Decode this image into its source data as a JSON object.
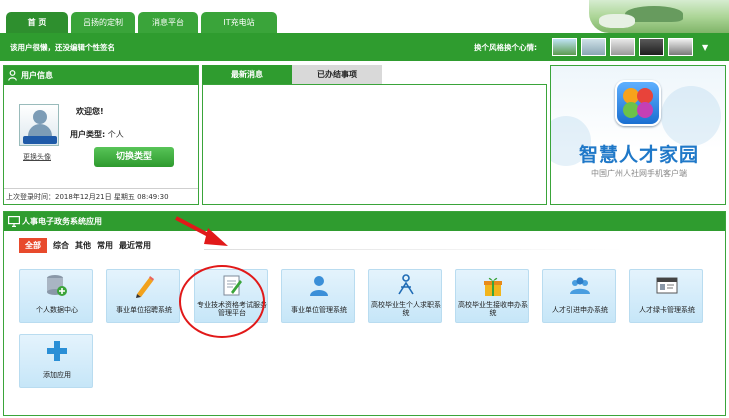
{
  "topnav": {
    "tabs": [
      {
        "label": "首 页"
      },
      {
        "label": "吕扬的定制"
      },
      {
        "label": "消息平台"
      },
      {
        "label": "IT充电站"
      }
    ]
  },
  "greenbar": {
    "signature_prompt": "该用户很懒，还没编辑个性签名",
    "style_label": "换个风格换个心情:",
    "style_options": [
      "landscape",
      "plane",
      "car",
      "dark-car",
      "silver-car"
    ]
  },
  "user_panel": {
    "title": "用户信息",
    "welcome": "欢迎您!",
    "user_type_label": "用户类型:",
    "user_type_value": "个人",
    "change_avatar": "更换头像",
    "switch_button": "切换类型",
    "last_login": "上次登录时间：2018年12月21日 星期五 08:49:30"
  },
  "news_panel": {
    "tabs": [
      {
        "label": "最新消息",
        "active": true
      },
      {
        "label": "已办结事项",
        "active": false
      }
    ]
  },
  "promo": {
    "title": "智慧人才家园",
    "subtitle": "中国广州人社网手机客户端"
  },
  "apps_panel": {
    "title": "人事电子政务系统应用",
    "filters": [
      {
        "label": "全部",
        "active": true
      },
      {
        "label": "综合",
        "active": false
      },
      {
        "label": "其他",
        "active": false
      },
      {
        "label": "常用",
        "active": false
      },
      {
        "label": "最近常用",
        "active": false
      }
    ],
    "apps": [
      {
        "label": "个人数据中心",
        "icon": "database-add-icon"
      },
      {
        "label": "事业单位招聘系统",
        "icon": "pencil-icon"
      },
      {
        "label": "专业技术资格考试服务管理平台",
        "icon": "document-icon"
      },
      {
        "label": "事业单位管理系统",
        "icon": "person-icon"
      },
      {
        "label": "高校毕业生个人求职系统",
        "icon": "figure-icon"
      },
      {
        "label": "高校毕业生接收申办系统",
        "icon": "gift-icon"
      },
      {
        "label": "人才引进申办系统",
        "icon": "group-icon"
      },
      {
        "label": "人才绿卡管理系统",
        "icon": "card-icon"
      },
      {
        "label": "添加应用",
        "icon": "plus-icon"
      }
    ]
  },
  "colors": {
    "brand_green": "#2f9c2f",
    "active_filter": "#e84a2c",
    "annotation_red": "#e11919",
    "promo_blue": "#1f78c8"
  }
}
